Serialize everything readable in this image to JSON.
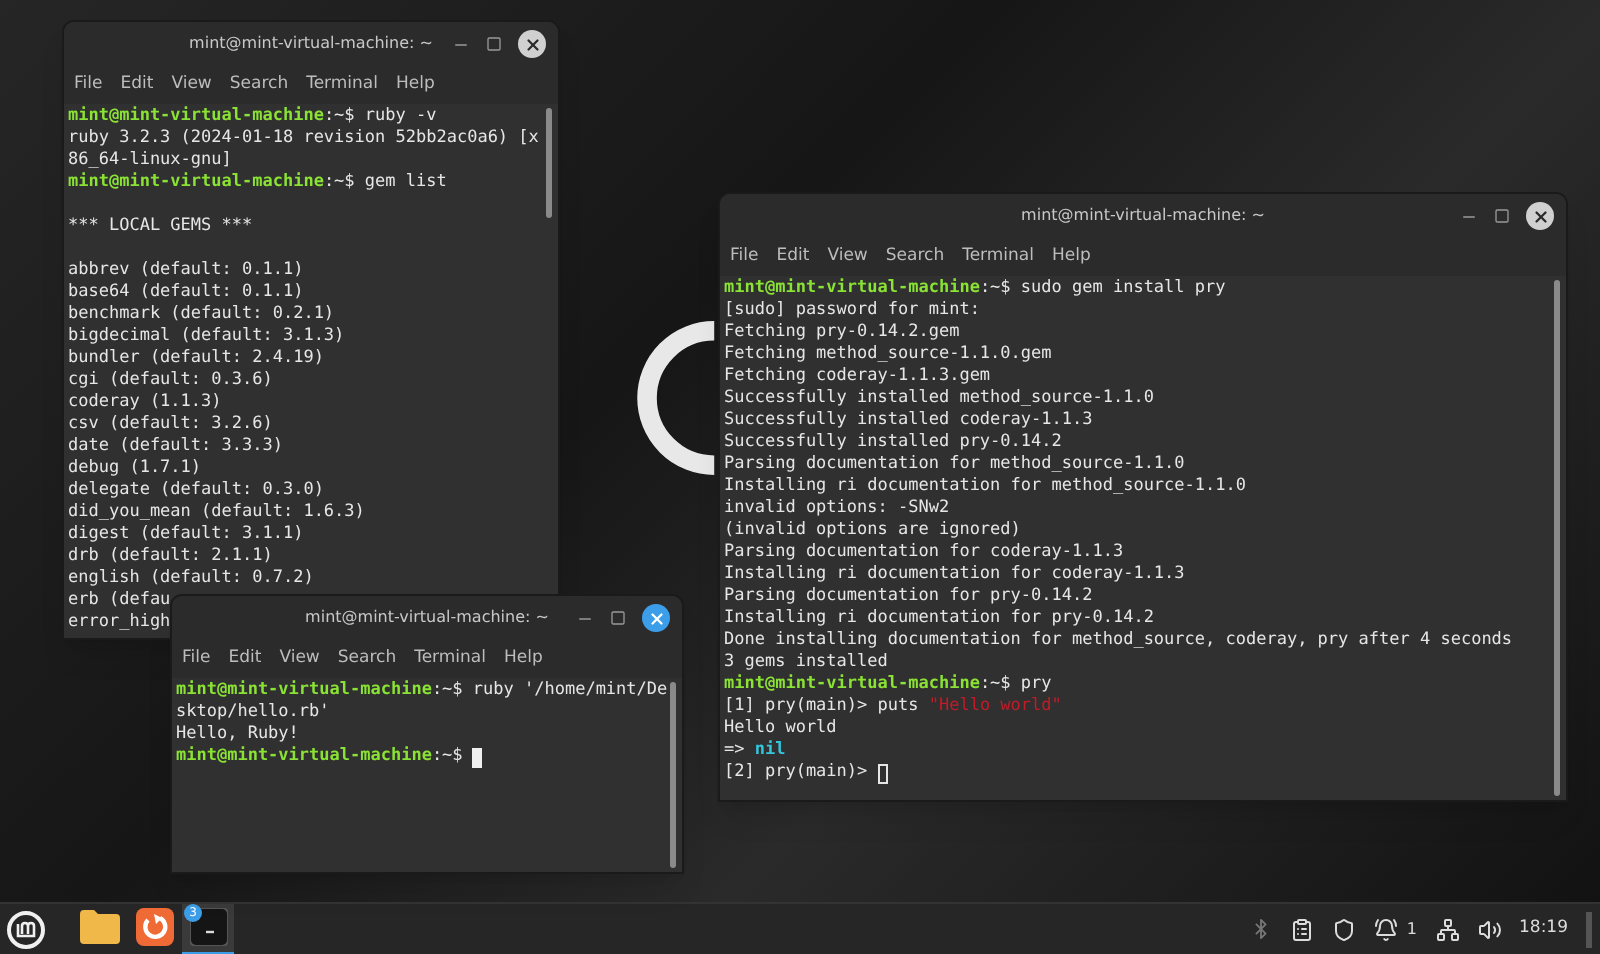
{
  "windows": [
    {
      "title": "mint@mint-virtual-machine: ~",
      "focused": false,
      "menu": [
        "File",
        "Edit",
        "View",
        "Search",
        "Terminal",
        "Help"
      ],
      "lines": [
        {
          "kind": "text",
          "segments": [
            {
              "kind": "host",
              "text": "mint@mint-virtual-machine"
            },
            {
              "kind": "plain",
              "text": ":~$ ruby -v"
            }
          ]
        },
        {
          "kind": "text",
          "segments": [
            {
              "kind": "plain",
              "text": "ruby 3.2.3 (2024-01-18 revision 52bb2ac0a6) [x"
            }
          ]
        },
        {
          "kind": "text",
          "segments": [
            {
              "kind": "plain",
              "text": "86_64-linux-gnu]"
            }
          ]
        },
        {
          "kind": "text",
          "segments": [
            {
              "kind": "host",
              "text": "mint@mint-virtual-machine"
            },
            {
              "kind": "plain",
              "text": ":~$ gem list"
            }
          ]
        },
        {
          "kind": "blank"
        },
        {
          "kind": "text",
          "segments": [
            {
              "kind": "plain",
              "text": "*** LOCAL GEMS ***"
            }
          ]
        },
        {
          "kind": "blank"
        },
        {
          "kind": "text",
          "segments": [
            {
              "kind": "plain",
              "text": "abbrev (default: 0.1.1)"
            }
          ]
        },
        {
          "kind": "text",
          "segments": [
            {
              "kind": "plain",
              "text": "base64 (default: 0.1.1)"
            }
          ]
        },
        {
          "kind": "text",
          "segments": [
            {
              "kind": "plain",
              "text": "benchmark (default: 0.2.1)"
            }
          ]
        },
        {
          "kind": "text",
          "segments": [
            {
              "kind": "plain",
              "text": "bigdecimal (default: 3.1.3)"
            }
          ]
        },
        {
          "kind": "text",
          "segments": [
            {
              "kind": "plain",
              "text": "bundler (default: 2.4.19)"
            }
          ]
        },
        {
          "kind": "text",
          "segments": [
            {
              "kind": "plain",
              "text": "cgi (default: 0.3.6)"
            }
          ]
        },
        {
          "kind": "text",
          "segments": [
            {
              "kind": "plain",
              "text": "coderay (1.1.3)"
            }
          ]
        },
        {
          "kind": "text",
          "segments": [
            {
              "kind": "plain",
              "text": "csv (default: 3.2.6)"
            }
          ]
        },
        {
          "kind": "text",
          "segments": [
            {
              "kind": "plain",
              "text": "date (default: 3.3.3)"
            }
          ]
        },
        {
          "kind": "text",
          "segments": [
            {
              "kind": "plain",
              "text": "debug (1.7.1)"
            }
          ]
        },
        {
          "kind": "text",
          "segments": [
            {
              "kind": "plain",
              "text": "delegate (default: 0.3.0)"
            }
          ]
        },
        {
          "kind": "text",
          "segments": [
            {
              "kind": "plain",
              "text": "did_you_mean (default: 1.6.3)"
            }
          ]
        },
        {
          "kind": "text",
          "segments": [
            {
              "kind": "plain",
              "text": "digest (default: 3.1.1)"
            }
          ]
        },
        {
          "kind": "text",
          "segments": [
            {
              "kind": "plain",
              "text": "drb (default: 2.1.1)"
            }
          ]
        },
        {
          "kind": "text",
          "segments": [
            {
              "kind": "plain",
              "text": "english (default: 0.7.2)"
            }
          ]
        },
        {
          "kind": "text",
          "segments": [
            {
              "kind": "plain",
              "text": "erb (defau"
            }
          ]
        },
        {
          "kind": "text",
          "segments": [
            {
              "kind": "plain",
              "text": "error_high"
            }
          ]
        }
      ]
    },
    {
      "title": "mint@mint-virtual-machine: ~",
      "focused": false,
      "menu": [
        "File",
        "Edit",
        "View",
        "Search",
        "Terminal",
        "Help"
      ],
      "lines": [
        {
          "kind": "text",
          "segments": [
            {
              "kind": "host",
              "text": "mint@mint-virtual-machine"
            },
            {
              "kind": "plain",
              "text": ":~$ sudo gem install pry"
            }
          ]
        },
        {
          "kind": "text",
          "segments": [
            {
              "kind": "plain",
              "text": "[sudo] password for mint:"
            }
          ]
        },
        {
          "kind": "text",
          "segments": [
            {
              "kind": "plain",
              "text": "Fetching pry-0.14.2.gem"
            }
          ]
        },
        {
          "kind": "text",
          "segments": [
            {
              "kind": "plain",
              "text": "Fetching method_source-1.1.0.gem"
            }
          ]
        },
        {
          "kind": "text",
          "segments": [
            {
              "kind": "plain",
              "text": "Fetching coderay-1.1.3.gem"
            }
          ]
        },
        {
          "kind": "text",
          "segments": [
            {
              "kind": "plain",
              "text": "Successfully installed method_source-1.1.0"
            }
          ]
        },
        {
          "kind": "text",
          "segments": [
            {
              "kind": "plain",
              "text": "Successfully installed coderay-1.1.3"
            }
          ]
        },
        {
          "kind": "text",
          "segments": [
            {
              "kind": "plain",
              "text": "Successfully installed pry-0.14.2"
            }
          ]
        },
        {
          "kind": "text",
          "segments": [
            {
              "kind": "plain",
              "text": "Parsing documentation for method_source-1.1.0"
            }
          ]
        },
        {
          "kind": "text",
          "segments": [
            {
              "kind": "plain",
              "text": "Installing ri documentation for method_source-1.1.0"
            }
          ]
        },
        {
          "kind": "text",
          "segments": [
            {
              "kind": "plain",
              "text": "invalid options: -SNw2"
            }
          ]
        },
        {
          "kind": "text",
          "segments": [
            {
              "kind": "plain",
              "text": "(invalid options are ignored)"
            }
          ]
        },
        {
          "kind": "text",
          "segments": [
            {
              "kind": "plain",
              "text": "Parsing documentation for coderay-1.1.3"
            }
          ]
        },
        {
          "kind": "text",
          "segments": [
            {
              "kind": "plain",
              "text": "Installing ri documentation for coderay-1.1.3"
            }
          ]
        },
        {
          "kind": "text",
          "segments": [
            {
              "kind": "plain",
              "text": "Parsing documentation for pry-0.14.2"
            }
          ]
        },
        {
          "kind": "text",
          "segments": [
            {
              "kind": "plain",
              "text": "Installing ri documentation for pry-0.14.2"
            }
          ]
        },
        {
          "kind": "text",
          "segments": [
            {
              "kind": "plain",
              "text": "Done installing documentation for method_source, coderay, pry after 4 seconds"
            }
          ]
        },
        {
          "kind": "text",
          "segments": [
            {
              "kind": "plain",
              "text": "3 gems installed"
            }
          ]
        },
        {
          "kind": "text",
          "segments": [
            {
              "kind": "host",
              "text": "mint@mint-virtual-machine"
            },
            {
              "kind": "plain",
              "text": ":~$ pry"
            }
          ]
        },
        {
          "kind": "text",
          "segments": [
            {
              "kind": "plain",
              "text": "[1] pry(main)> puts "
            },
            {
              "kind": "string",
              "text": "\"Hello world\""
            }
          ]
        },
        {
          "kind": "text",
          "segments": [
            {
              "kind": "plain",
              "text": "Hello world"
            }
          ]
        },
        {
          "kind": "text",
          "segments": [
            {
              "kind": "plain",
              "text": "=> "
            },
            {
              "kind": "value",
              "text": "nil"
            }
          ]
        },
        {
          "kind": "text",
          "cursor": true,
          "segments": [
            {
              "kind": "plain",
              "text": "[2] pry(main)> "
            }
          ]
        }
      ]
    },
    {
      "title": "mint@mint-virtual-machine: ~",
      "focused": true,
      "menu": [
        "File",
        "Edit",
        "View",
        "Search",
        "Terminal",
        "Help"
      ],
      "lines": [
        {
          "kind": "text",
          "segments": [
            {
              "kind": "host",
              "text": "mint@mint-virtual-machine"
            },
            {
              "kind": "plain",
              "text": ":~$ ruby '/home/mint/De"
            }
          ]
        },
        {
          "kind": "text",
          "segments": [
            {
              "kind": "plain",
              "text": "sktop/hello.rb'"
            }
          ]
        },
        {
          "kind": "text",
          "segments": [
            {
              "kind": "plain",
              "text": "Hello, Ruby!"
            }
          ]
        },
        {
          "kind": "text",
          "cursor": true,
          "segments": [
            {
              "kind": "host",
              "text": "mint@mint-virtual-machine"
            },
            {
              "kind": "plain",
              "text": ":~$ "
            }
          ]
        }
      ]
    }
  ],
  "taskbar": {
    "apps": [
      {
        "kind": "folder",
        "selected": false
      },
      {
        "kind": "browser",
        "selected": false
      },
      {
        "kind": "terminal",
        "selected": true,
        "badge": "3"
      }
    ],
    "notifications": "1",
    "clock": "18:19"
  }
}
